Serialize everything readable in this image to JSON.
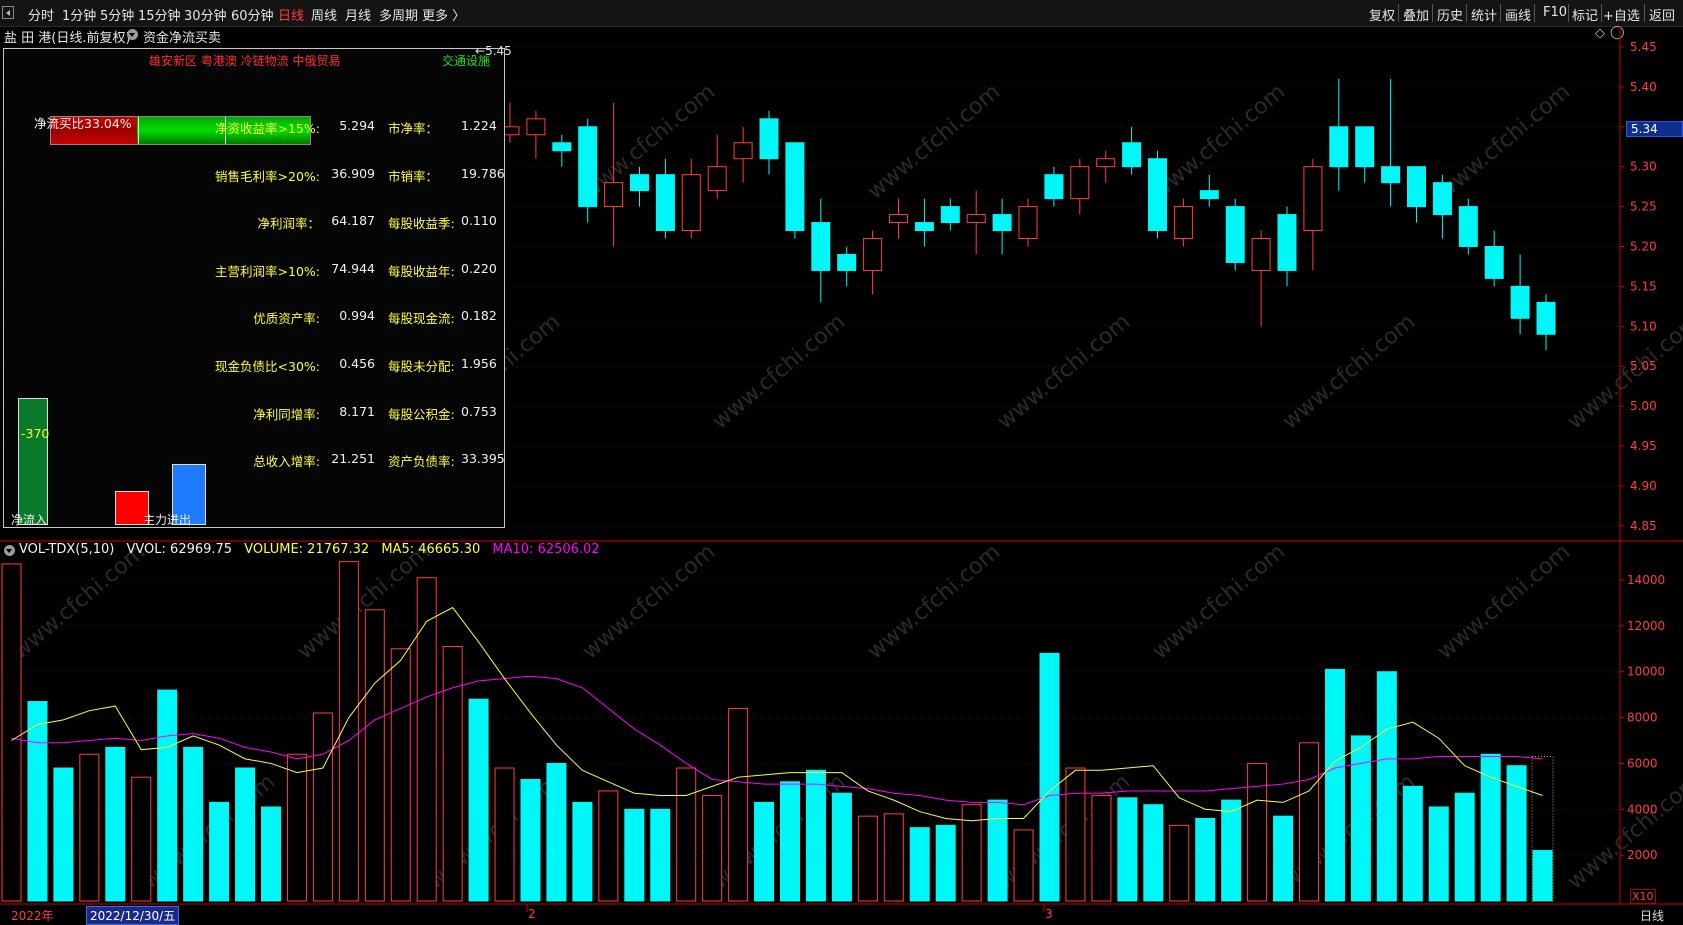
{
  "toolbar": {
    "periods": [
      "分时",
      "1分钟",
      "5分钟",
      "15分钟",
      "30分钟",
      "60分钟",
      "日线",
      "周线",
      "月线",
      "多周期",
      "更多 〉"
    ],
    "active_period": "日线",
    "right_buttons": [
      "复权",
      "叠加",
      "历史",
      "统计",
      "画线",
      "F10",
      "标记",
      "+自选",
      "返回"
    ]
  },
  "title": {
    "stock": "盐 田 港(日线.前复权)",
    "indicator": "资金净流买卖"
  },
  "chart": {
    "type": "candlestick",
    "price_ticks": [
      "5.45",
      "5.40",
      "5.35",
      "5.30",
      "5.25",
      "5.20",
      "5.15",
      "5.10",
      "5.05",
      "5.00",
      "4.95",
      "4.90",
      "4.85"
    ],
    "current_price": "5.34",
    "high_label": "5.45",
    "candles": [
      {
        "o": 5.34,
        "c": 5.35,
        "h": 5.38,
        "l": 5.33
      },
      {
        "o": 5.34,
        "c": 5.36,
        "h": 5.37,
        "l": 5.31
      },
      {
        "o": 5.33,
        "c": 5.32,
        "h": 5.34,
        "l": 5.3
      },
      {
        "o": 5.35,
        "c": 5.25,
        "h": 5.36,
        "l": 5.23
      },
      {
        "o": 5.25,
        "c": 5.28,
        "h": 5.38,
        "l": 5.2
      },
      {
        "o": 5.29,
        "c": 5.27,
        "h": 5.3,
        "l": 5.25
      },
      {
        "o": 5.29,
        "c": 5.22,
        "h": 5.31,
        "l": 5.21
      },
      {
        "o": 5.22,
        "c": 5.29,
        "h": 5.31,
        "l": 5.21
      },
      {
        "o": 5.27,
        "c": 5.3,
        "h": 5.34,
        "l": 5.26
      },
      {
        "o": 5.31,
        "c": 5.33,
        "h": 5.35,
        "l": 5.28
      },
      {
        "o": 5.36,
        "c": 5.31,
        "h": 5.37,
        "l": 5.29
      },
      {
        "o": 5.33,
        "c": 5.22,
        "h": 5.33,
        "l": 5.21
      },
      {
        "o": 5.23,
        "c": 5.17,
        "h": 5.26,
        "l": 5.13
      },
      {
        "o": 5.19,
        "c": 5.17,
        "h": 5.2,
        "l": 5.15
      },
      {
        "o": 5.17,
        "c": 5.21,
        "h": 5.22,
        "l": 5.14
      },
      {
        "o": 5.23,
        "c": 5.24,
        "h": 5.26,
        "l": 5.21
      },
      {
        "o": 5.23,
        "c": 5.22,
        "h": 5.26,
        "l": 5.2
      },
      {
        "o": 5.25,
        "c": 5.23,
        "h": 5.26,
        "l": 5.22
      },
      {
        "o": 5.23,
        "c": 5.24,
        "h": 5.27,
        "l": 5.19
      },
      {
        "o": 5.24,
        "c": 5.22,
        "h": 5.26,
        "l": 5.19
      },
      {
        "o": 5.21,
        "c": 5.25,
        "h": 5.26,
        "l": 5.2
      },
      {
        "o": 5.29,
        "c": 5.26,
        "h": 5.3,
        "l": 5.25
      },
      {
        "o": 5.26,
        "c": 5.3,
        "h": 5.31,
        "l": 5.24
      },
      {
        "o": 5.3,
        "c": 5.31,
        "h": 5.32,
        "l": 5.28
      },
      {
        "o": 5.33,
        "c": 5.3,
        "h": 5.35,
        "l": 5.29
      },
      {
        "o": 5.31,
        "c": 5.22,
        "h": 5.32,
        "l": 5.21
      },
      {
        "o": 5.21,
        "c": 5.25,
        "h": 5.26,
        "l": 5.2
      },
      {
        "o": 5.27,
        "c": 5.26,
        "h": 5.29,
        "l": 5.25
      },
      {
        "o": 5.25,
        "c": 5.18,
        "h": 5.26,
        "l": 5.17
      },
      {
        "o": 5.17,
        "c": 5.21,
        "h": 5.22,
        "l": 5.1
      },
      {
        "o": 5.24,
        "c": 5.17,
        "h": 5.25,
        "l": 5.15
      },
      {
        "o": 5.22,
        "c": 5.3,
        "h": 5.31,
        "l": 5.17
      },
      {
        "o": 5.35,
        "c": 5.3,
        "h": 5.41,
        "l": 5.27
      },
      {
        "o": 5.35,
        "c": 5.3,
        "h": 5.35,
        "l": 5.28
      },
      {
        "o": 5.3,
        "c": 5.28,
        "h": 5.41,
        "l": 5.25
      },
      {
        "o": 5.3,
        "c": 5.25,
        "h": 5.3,
        "l": 5.23
      },
      {
        "o": 5.28,
        "c": 5.24,
        "h": 5.29,
        "l": 5.21
      },
      {
        "o": 5.25,
        "c": 5.2,
        "h": 5.26,
        "l": 5.19
      },
      {
        "o": 5.2,
        "c": 5.16,
        "h": 5.22,
        "l": 5.15
      },
      {
        "o": 5.15,
        "c": 5.11,
        "h": 5.19,
        "l": 5.09
      },
      {
        "o": 5.13,
        "c": 5.09,
        "h": 5.14,
        "l": 5.07
      }
    ]
  },
  "panel": {
    "concepts_red": "雄安新区 粤港澳 冷链物流 中俄贸易",
    "concept_green": "交通设施",
    "netflow_ratio_label": "净流买比33.04%",
    "netflow_ratio": 0.3304,
    "rows": [
      {
        "label": "净资收益率>15%:",
        "value": "5.294",
        "label2": "市净率：",
        "value2": "1.224"
      },
      {
        "label": "销售毛利率>20%:",
        "value": "36.909",
        "label2": "市销率：",
        "value2": "19.786"
      },
      {
        "label": "净利润率：",
        "value": "64.187",
        "label2": "每股收益季:",
        "value2": "0.110"
      },
      {
        "label": "主营利润率>10%:",
        "value": "74.944",
        "label2": "每股收益年:",
        "value2": "0.220"
      },
      {
        "label": "优质资产率:",
        "value": "0.994",
        "label2": "每股现金流:",
        "value2": "0.182"
      },
      {
        "label": "现金负债比<30%:",
        "value": "0.456",
        "label2": "每股未分配:",
        "value2": "1.956"
      },
      {
        "label": "净利同增率:",
        "value": "8.171",
        "label2": "每股公积金:",
        "value2": "0.753"
      },
      {
        "label": "总收入增率:",
        "value": "21.251",
        "label2": "资产负债率:",
        "value2": "33.395"
      }
    ],
    "netflow_value": "-370",
    "netflow_in_label": "净流入",
    "main_flow_label": "主力进出"
  },
  "volume": {
    "header": {
      "name": "VOL-TDX(5,10)",
      "vvol": "VVOL: 62969.75",
      "volume": "VOLUME: 21767.32",
      "ma5": "MA5: 46665.30",
      "ma10": "MA10: 62506.02"
    },
    "ticks": [
      "14000",
      "12000",
      "10000",
      "8000",
      "6000",
      "4000",
      "2000"
    ],
    "unit": "X10",
    "bars": [
      {
        "v": 14700,
        "up": true
      },
      {
        "v": 8700,
        "up": false
      },
      {
        "v": 5800,
        "up": false
      },
      {
        "v": 6400,
        "up": true
      },
      {
        "v": 6700,
        "up": false
      },
      {
        "v": 5400,
        "up": true
      },
      {
        "v": 9200,
        "up": false
      },
      {
        "v": 6700,
        "up": false
      },
      {
        "v": 4300,
        "up": false
      },
      {
        "v": 5800,
        "up": false
      },
      {
        "v": 4100,
        "up": false
      },
      {
        "v": 6400,
        "up": true
      },
      {
        "v": 8200,
        "up": true
      },
      {
        "v": 14800,
        "up": true
      },
      {
        "v": 12700,
        "up": true
      },
      {
        "v": 11000,
        "up": true
      },
      {
        "v": 14100,
        "up": true
      },
      {
        "v": 11100,
        "up": true
      },
      {
        "v": 8800,
        "up": false
      },
      {
        "v": 5800,
        "up": true
      },
      {
        "v": 5300,
        "up": false
      },
      {
        "v": 6000,
        "up": false
      },
      {
        "v": 4300,
        "up": false
      },
      {
        "v": 4800,
        "up": true
      },
      {
        "v": 4000,
        "up": false
      },
      {
        "v": 4000,
        "up": false
      },
      {
        "v": 5800,
        "up": true
      },
      {
        "v": 4600,
        "up": true
      },
      {
        "v": 8400,
        "up": true
      },
      {
        "v": 4300,
        "up": false
      },
      {
        "v": 5200,
        "up": false
      },
      {
        "v": 5700,
        "up": false
      },
      {
        "v": 4700,
        "up": false
      },
      {
        "v": 3700,
        "up": true
      },
      {
        "v": 3800,
        "up": true
      },
      {
        "v": 3200,
        "up": false
      },
      {
        "v": 3300,
        "up": false
      },
      {
        "v": 4200,
        "up": true
      },
      {
        "v": 4400,
        "up": false
      },
      {
        "v": 3100,
        "up": true
      },
      {
        "v": 10800,
        "up": false
      },
      {
        "v": 5800,
        "up": true
      },
      {
        "v": 4600,
        "up": true
      },
      {
        "v": 4500,
        "up": false
      },
      {
        "v": 4200,
        "up": false
      },
      {
        "v": 3300,
        "up": true
      },
      {
        "v": 3600,
        "up": false
      },
      {
        "v": 4400,
        "up": false
      },
      {
        "v": 6000,
        "up": true
      },
      {
        "v": 3700,
        "up": false
      },
      {
        "v": 6900,
        "up": true
      },
      {
        "v": 10100,
        "up": false
      },
      {
        "v": 7200,
        "up": false
      },
      {
        "v": 10000,
        "up": false
      },
      {
        "v": 5000,
        "up": false
      },
      {
        "v": 4100,
        "up": false
      },
      {
        "v": 4700,
        "up": false
      },
      {
        "v": 6400,
        "up": false
      },
      {
        "v": 5900,
        "up": false
      },
      {
        "v": 2200,
        "up": false
      }
    ],
    "ma5": [
      7000,
      7700,
      7900,
      8300,
      8500,
      6600,
      6700,
      7200,
      6800,
      6200,
      6000,
      5600,
      5800,
      8000,
      9500,
      10500,
      12200,
      12800,
      11300,
      9700,
      8200,
      6800,
      5700,
      5200,
      4700,
      4600,
      4600,
      5000,
      5400,
      5500,
      5600,
      5600,
      5600,
      4800,
      4400,
      3900,
      3600,
      3500,
      3600,
      3600,
      4800,
      5700,
      5700,
      5800,
      5900,
      4500,
      4000,
      3900,
      4400,
      4300,
      4800,
      6100,
      6700,
      7500,
      7800,
      7100,
      5900,
      5400,
      5000,
      4600
    ],
    "ma10": [
      7100,
      6900,
      6900,
      7000,
      7100,
      7000,
      7200,
      7300,
      7100,
      6700,
      6500,
      6200,
      6400,
      7000,
      7900,
      8400,
      8900,
      9300,
      9600,
      9700,
      9800,
      9700,
      9300,
      8400,
      7500,
      6800,
      6000,
      5300,
      5200,
      5100,
      5100,
      5100,
      5000,
      4900,
      4700,
      4600,
      4400,
      4300,
      4300,
      4200,
      4600,
      4700,
      4700,
      4800,
      4800,
      4800,
      4800,
      4900,
      5000,
      5100,
      5300,
      5800,
      6000,
      6200,
      6200,
      6300,
      6300,
      6300,
      6300,
      6200
    ]
  },
  "xaxis": {
    "year_label": "2022年",
    "cursor_date": "2022/12/30/五",
    "m2": "2",
    "m3": "3",
    "period": "日线"
  },
  "watermark": "www.cfchi.com",
  "colors": {
    "up": "#ff3d3d",
    "down": "#00f7f7",
    "ma5": "#ffff33",
    "ma10": "#ff00ff",
    "grid": "#5a0000"
  }
}
